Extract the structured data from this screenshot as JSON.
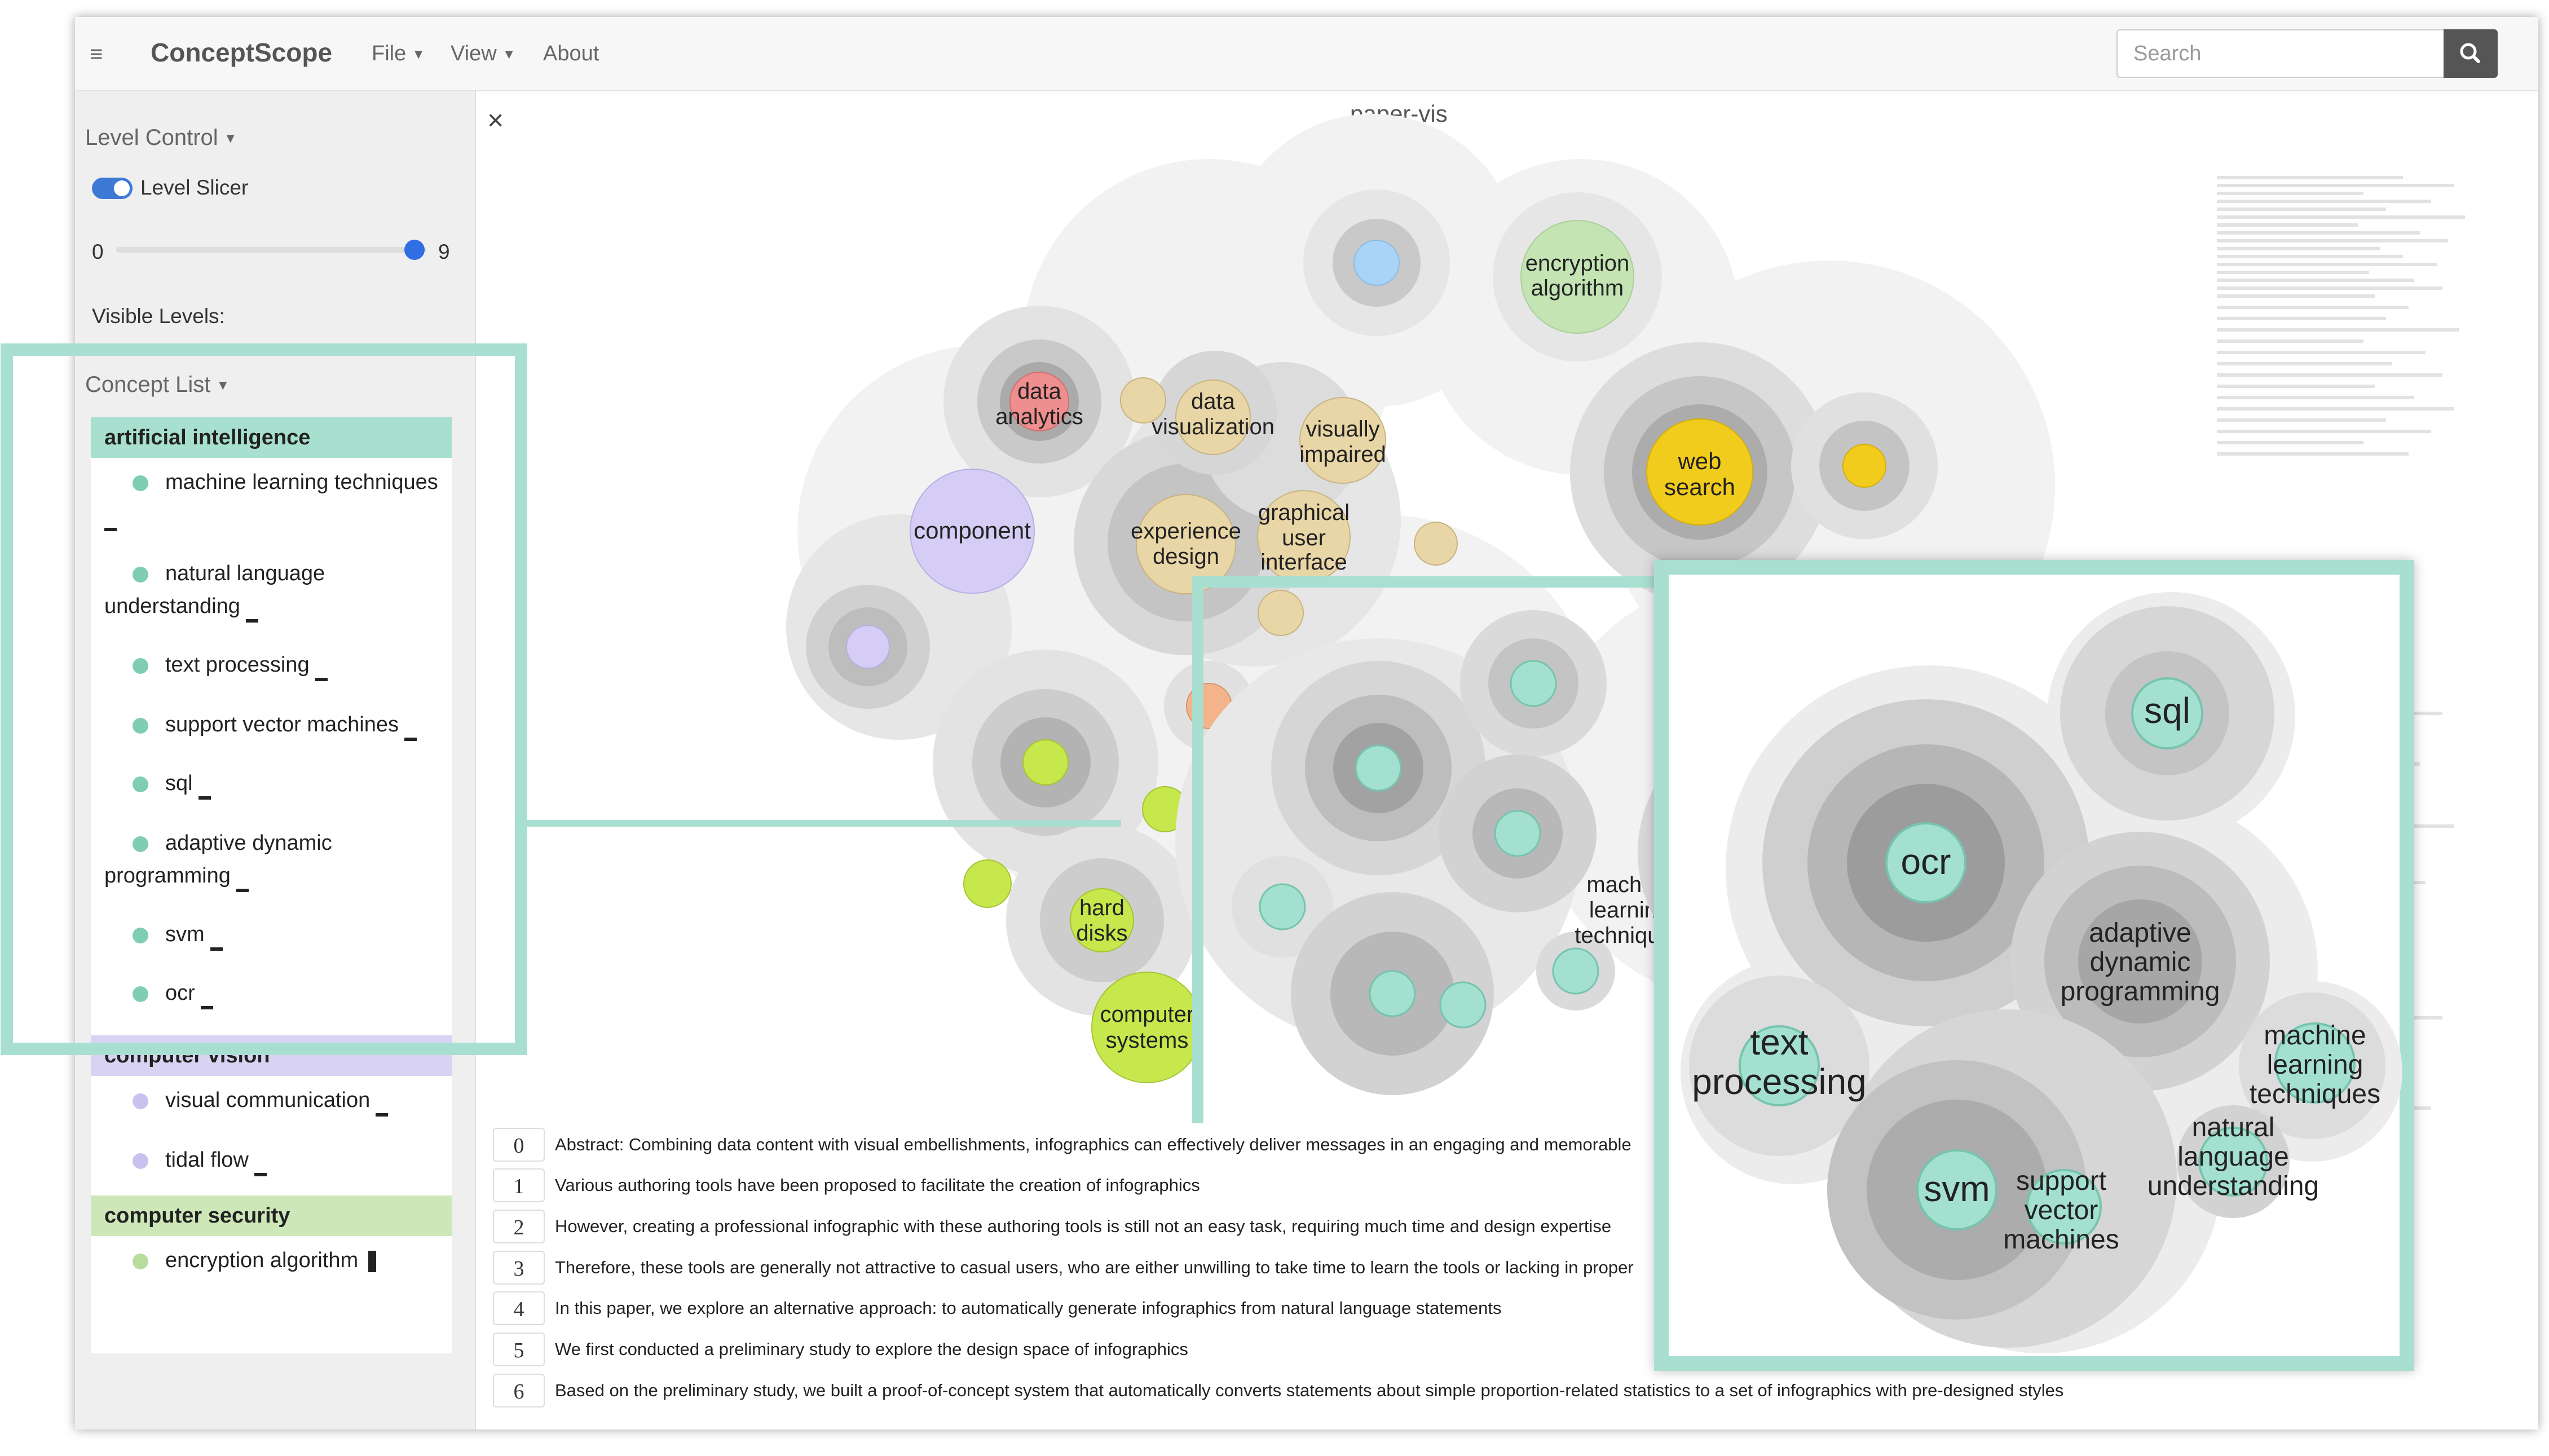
{
  "navbar": {
    "brand": "ConceptScope",
    "menus": [
      {
        "label": "File"
      },
      {
        "label": "View"
      },
      {
        "label": "About"
      }
    ],
    "search": {
      "placeholder": "Search"
    }
  },
  "sidebar": {
    "level_control_title": "Level Control",
    "level_slicer": {
      "label": "Level Slicer",
      "enabled": true
    },
    "slider": {
      "min": "0",
      "max": "9",
      "value": 9
    },
    "visible_levels_label": "Visible Levels:",
    "concept_list_title": "Concept List",
    "categories": [
      {
        "name": "artificial intelligence",
        "color": "#a8e0cf",
        "dot": "#7fcdb5",
        "items": [
          "machine learning techniques",
          "natural language understanding",
          "text processing",
          "support vector machines",
          "sql",
          "adaptive dynamic programming",
          "svm",
          "ocr"
        ]
      },
      {
        "name": "computer vision",
        "color": "#d8d3f3",
        "dot": "#c9c1ee",
        "items": [
          "visual communication",
          "tidal flow"
        ]
      },
      {
        "name": "computer security",
        "color": "#cde7b9",
        "dot": "#b7dd9c",
        "items": [
          "encryption algorithm"
        ]
      }
    ]
  },
  "main": {
    "close_label": "×",
    "graph_title": "paper-vis",
    "graph_labels": {
      "encryption_algorithm": [
        "encryption",
        "algorithm"
      ],
      "data_analytics": [
        "data",
        "analytics"
      ],
      "data_visualization": [
        "data",
        "visualization"
      ],
      "visually_impaired": [
        "visually",
        "impaired"
      ],
      "web_search": [
        "web",
        "search"
      ],
      "component": "component",
      "experience_design": [
        "experience",
        "design"
      ],
      "graphical_user_interface": [
        "graphical",
        "user",
        "interface"
      ],
      "machine_learning_techniques": [
        "machine",
        "learning",
        "techniques"
      ],
      "hard_disks": [
        "hard",
        "disks"
      ],
      "computer_systems": [
        "computer",
        "systems"
      ]
    },
    "zoom_labels": {
      "sql": "sql",
      "ocr": "ocr",
      "adaptive_dynamic_programming": [
        "adaptive",
        "dynamic",
        "programming"
      ],
      "text_processing": [
        "text",
        "processing"
      ],
      "machine_learning_techniques": [
        "machine",
        "learning",
        "techniques"
      ],
      "natural_language_understanding": [
        "natural",
        "language",
        "understanding"
      ],
      "svm": "svm",
      "support_vector_machines": [
        "support",
        "vector",
        "machines"
      ]
    },
    "sentences": [
      {
        "index": "0",
        "text": "Abstract: Combining data content with visual embellishments, infographics can effectively deliver messages in an engaging and memorable"
      },
      {
        "index": "1",
        "text": "Various authoring tools have been proposed to facilitate the creation of infographics"
      },
      {
        "index": "2",
        "text": "However, creating a professional infographic with these authoring tools is still not an easy task, requiring much time and design expertise"
      },
      {
        "index": "3",
        "text": "Therefore, these tools are generally not attractive to casual users, who are either unwilling to take time to learn the tools or lacking in proper"
      },
      {
        "index": "4",
        "text": "In this paper, we explore an alternative approach: to automatically generate infographics from natural language statements"
      },
      {
        "index": "5",
        "text": "We first conducted a preliminary study to explore the design space of infographics"
      },
      {
        "index": "6",
        "text": "Based on the preliminary study, we built a proof-of-concept system that automatically converts statements about simple proportion-related statistics to a set of infographics with pre-designed styles"
      }
    ]
  },
  "colors": {
    "highlight_frame": "#a9dfd0",
    "teal_node": "#a4e0d0",
    "green_node": "#c6e84c",
    "tan_node": "#e9d6a6",
    "yellow_node": "#f2cc1d",
    "purple_node": "#d5cdf5",
    "red_node": "#ef8e8e",
    "orange_node": "#f3b48c",
    "light_green_node": "#c4e4b4",
    "blue_node": "#a9d3f7"
  }
}
